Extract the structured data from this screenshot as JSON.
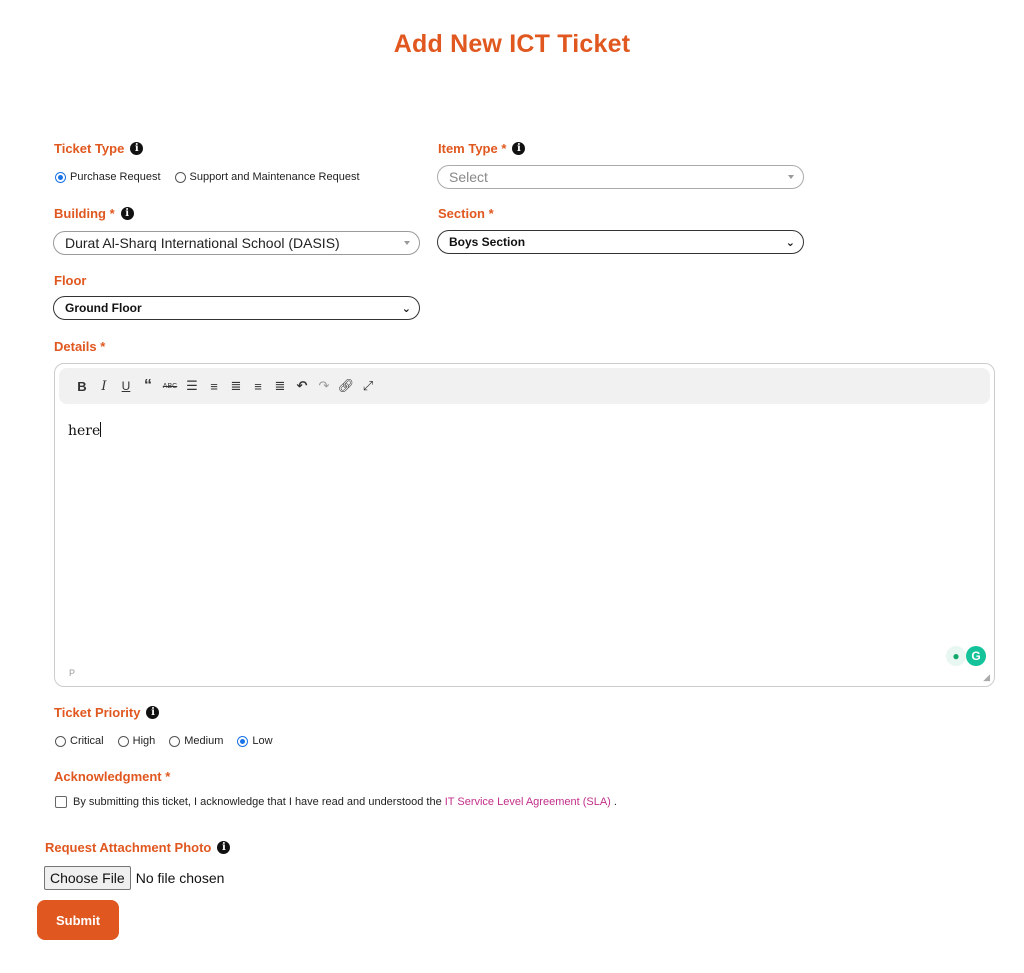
{
  "page": {
    "title": "Add New ICT Ticket"
  },
  "ticket_type": {
    "label": "Ticket Type",
    "options": [
      "Purchase Request",
      "Support and Maintenance Request"
    ],
    "selected": "Purchase Request"
  },
  "item_type": {
    "label": "Item Type",
    "required": "*",
    "placeholder": "Select"
  },
  "building": {
    "label": "Building",
    "required": "*",
    "value": "Durat Al-Sharq International School (DASIS)"
  },
  "section": {
    "label": "Section",
    "required": "*",
    "value": "Boys Section"
  },
  "floor": {
    "label": "Floor",
    "value": "Ground Floor"
  },
  "details": {
    "label": "Details",
    "required": "*",
    "content": "here",
    "status_path": "P",
    "toolbar": [
      "bold-icon",
      "italic-icon",
      "underline-icon",
      "quote-icon",
      "strikethrough-icon",
      "bullet-list-icon",
      "numbered-list-icon",
      "align-left-icon",
      "align-center-icon",
      "align-right-icon",
      "undo-icon",
      "redo-icon",
      "link-icon",
      "fullscreen-icon"
    ]
  },
  "priority": {
    "label": "Ticket Priority",
    "options": [
      "Critical",
      "High",
      "Medium",
      "Low"
    ],
    "selected": "Low"
  },
  "acknowledgment": {
    "label": "Acknowledgment",
    "required": "*",
    "text": "By submitting this ticket, I acknowledge that I have read and understood the",
    "link_text": "IT Service Level Agreement (SLA)",
    "suffix": "."
  },
  "attachment": {
    "label": "Request Attachment Photo",
    "button": "Choose File",
    "status": "No file chosen"
  },
  "submit": {
    "label": "Submit"
  },
  "colors": {
    "accent": "#e0571f",
    "link": "#c22f8a",
    "radio": "#1a73e8"
  }
}
